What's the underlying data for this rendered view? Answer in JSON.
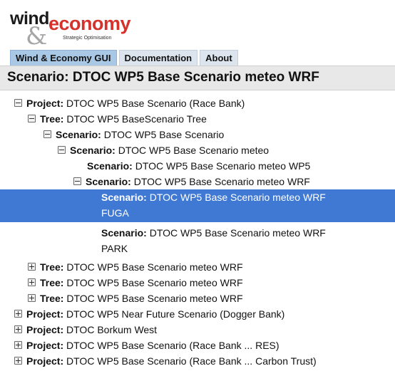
{
  "logo": {
    "word1": "wind",
    "word2": "economy",
    "amp": "&",
    "tagline": "Strategic Optimisation"
  },
  "tabs": [
    {
      "label": "Wind & Economy GUI",
      "active": true
    },
    {
      "label": "Documentation",
      "active": false
    },
    {
      "label": "About",
      "active": false
    }
  ],
  "page_title": "Scenario: DTOC WP5 Base Scenario meteo WRF",
  "tree": {
    "rows": [
      {
        "kind": "Project:",
        "name": "DTOC WP5 Base Scenario (Race Bank)",
        "toggle": "minus"
      },
      {
        "kind": "Tree:",
        "name": "DTOC WP5 BaseScenario Tree",
        "toggle": "minus"
      },
      {
        "kind": "Scenario:",
        "name": "DTOC WP5 Base Scenario",
        "toggle": "minus"
      },
      {
        "kind": "Scenario:",
        "name": "DTOC WP5 Base Scenario meteo",
        "toggle": "minus"
      },
      {
        "kind": "Scenario:",
        "name": "DTOC WP5 Base Scenario meteo WP5",
        "toggle": "none"
      },
      {
        "kind": "Scenario:",
        "name": "DTOC WP5 Base Scenario meteo WRF",
        "toggle": "minus"
      },
      {
        "kind": "Scenario:",
        "name": "DTOC WP5 Base Scenario meteo WRF",
        "name2": "FUGA",
        "toggle": "none",
        "selected": true
      },
      {
        "kind": "Scenario:",
        "name": "DTOC WP5 Base Scenario meteo WRF",
        "name2": "PARK",
        "toggle": "none"
      },
      {
        "kind": "Tree:",
        "name": "DTOC WP5 Base Scenario meteo WRF",
        "toggle": "plus"
      },
      {
        "kind": "Tree:",
        "name": "DTOC WP5 Base Scenario meteo WRF",
        "toggle": "plus"
      },
      {
        "kind": "Tree:",
        "name": "DTOC WP5 Base Scenario meteo WRF",
        "toggle": "plus"
      },
      {
        "kind": "Project:",
        "name": "DTOC WP5 Near Future Scenario (Dogger Bank)",
        "toggle": "plus"
      },
      {
        "kind": "Project:",
        "name": "DTOC Borkum West",
        "toggle": "plus"
      },
      {
        "kind": "Project:",
        "name": "DTOC WP5 Base Scenario (Race Bank ... RES)",
        "toggle": "plus"
      },
      {
        "kind": "Project:",
        "name": "DTOC WP5 Base Scenario (Race Bank ... Carbon Trust)",
        "toggle": "plus"
      }
    ]
  }
}
